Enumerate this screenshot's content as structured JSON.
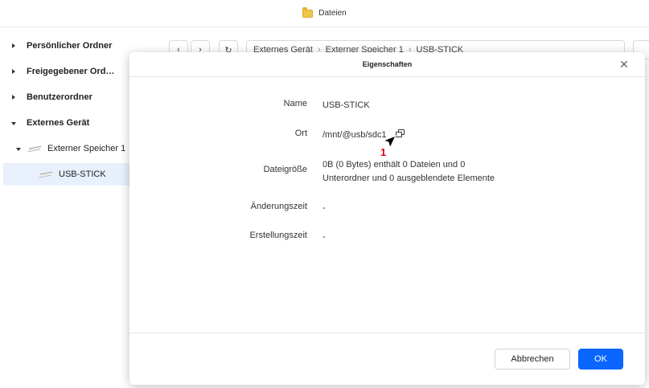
{
  "window": {
    "title": "Dateien"
  },
  "sidebar": {
    "items": [
      {
        "label": "Persönlicher Ordner"
      },
      {
        "label": "Freigegebener Ord…"
      },
      {
        "label": "Benutzerordner"
      },
      {
        "label": "Externes Gerät"
      },
      {
        "label": "Externer Speicher 1"
      },
      {
        "label": "USB-STICK"
      }
    ]
  },
  "breadcrumb": {
    "parts": [
      "Externes Gerät",
      "Externer Speicher 1",
      "USB-STICK"
    ]
  },
  "dialog": {
    "title": "Eigenschaften",
    "rows": [
      {
        "label": "Name",
        "value": "USB-STICK"
      },
      {
        "label": "Ort",
        "value": "/mnt/@usb/sdc1"
      },
      {
        "label": "Dateigröße",
        "value_line1": "0B (0 Bytes) enthält 0 Dateien und 0",
        "value_line2": "Unterordner und 0 ausgeblendete Elemente"
      },
      {
        "label": "Änderungszeit",
        "value": "-"
      },
      {
        "label": "Erstellungszeit",
        "value": "-"
      }
    ],
    "annotation": "1",
    "buttons": {
      "cancel": "Abbrechen",
      "ok": "OK"
    }
  },
  "colors": {
    "accent": "#0a66ff",
    "selection": "#e8f0fc",
    "annotation": "#d9001b"
  }
}
